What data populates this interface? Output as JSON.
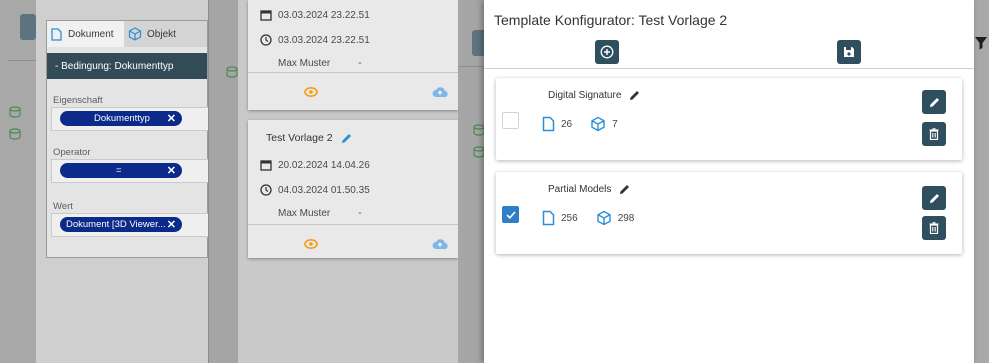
{
  "filter_panel": {
    "tabs": [
      {
        "label": "Dokument",
        "icon": "document-icon",
        "active": true
      },
      {
        "label": "Objekt",
        "icon": "cube-icon",
        "active": false
      }
    ],
    "section_title": "- Bedingung: Dokumenttyp",
    "fields": [
      {
        "label": "Eigenschaft",
        "chip": "Dokumenttyp"
      },
      {
        "label": "Operator",
        "chip": "="
      },
      {
        "label": "Wert",
        "chip": "Dokument [3D Viewer..."
      }
    ]
  },
  "template_list": {
    "cards": [
      {
        "name": "",
        "created": "03.03.2024 23.22.51",
        "modified": "03.03.2024 23.22.51",
        "author": "Max Muster",
        "extra": "-"
      },
      {
        "name": "Test Vorlage 2",
        "created": "20.02.2024 14.04.26",
        "modified": "04.03.2024 01.50.35",
        "author": "Max Muster",
        "extra": "-"
      }
    ]
  },
  "dialog": {
    "title": "Template Konfigurator: Test Vorlage 2",
    "templates": [
      {
        "name": "Digital Signature",
        "documents": "26",
        "objects": "7",
        "checked": false
      },
      {
        "name": "Partial Models",
        "documents": "256",
        "objects": "298",
        "checked": true
      }
    ]
  },
  "colors": {
    "accent": "#2f4f5e",
    "chip": "#0b2a8a",
    "orange": "#f39c12",
    "light_blue": "#7fb6e6",
    "icon_blue": "#2a8fd8",
    "checkbox": "#2f7fc8"
  }
}
